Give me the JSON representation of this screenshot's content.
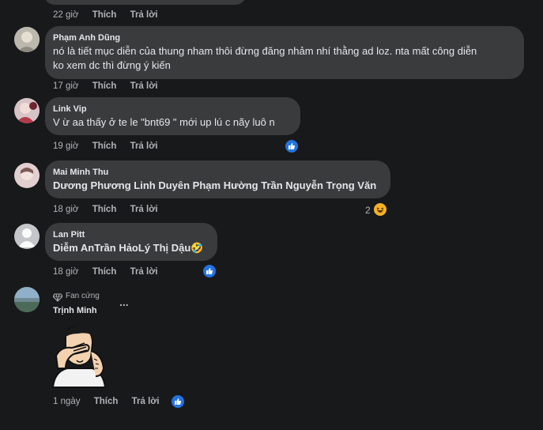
{
  "comments": [
    {
      "time": "22 giờ",
      "like": "Thích",
      "reply": "Trả lời"
    },
    {
      "name": "Phạm Anh Dũng",
      "line1": "nó là tiết mục diễn của thung nham thôi đừng đăng nhảm nhí thằng ad loz. nta mất công diễn",
      "line2": "ko xem dc thì đừng ý kiến",
      "time": "17 giờ",
      "like": "Thích",
      "reply": "Trả lời"
    },
    {
      "name": "Link Vip",
      "line1": "V ừ aa thấy ở te le \"bnt69 \" mới up lú c nãy luô n",
      "time": "19 giờ",
      "like": "Thích",
      "reply": "Trả lời",
      "reaction": "like"
    },
    {
      "name": "Mai Minh Thu",
      "line1": "Dương Phương Linh Duyên Phạm Hường Trần Nguyễn Trọng Văn",
      "time": "18 giờ",
      "like": "Thích",
      "reply": "Trả lời",
      "reaction": "haha",
      "reaction_count": "2"
    },
    {
      "name": "Lan Pitt",
      "line1": "Diễm AnTrần HảoLý Thị Dậu🤣",
      "time": "18 giờ",
      "like": "Thích",
      "reply": "Trả lời",
      "reaction": "like"
    },
    {
      "badge": "Fan cứng",
      "name": "Trịnh Minh",
      "more": "...",
      "time": "1 ngày",
      "like": "Thích",
      "reply": "Trả lời",
      "reaction": "like"
    }
  ],
  "colors": {
    "bg": "#18191a",
    "bubble": "#3a3b3c",
    "text": "#e4e6eb",
    "meta": "#b0b3b8",
    "like_blue": "#2374e1"
  }
}
